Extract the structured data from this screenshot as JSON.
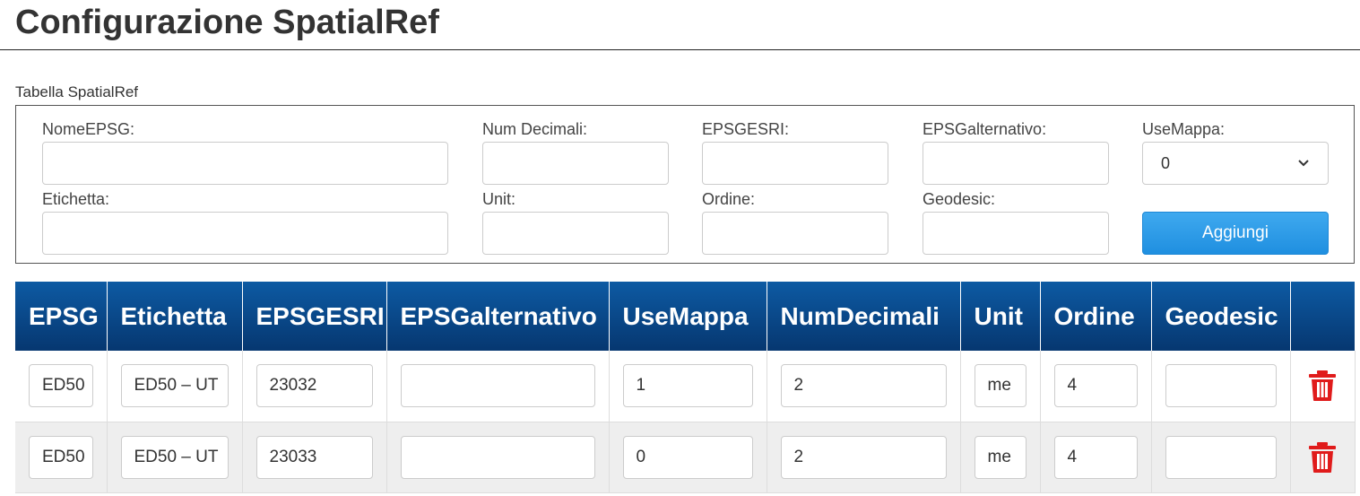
{
  "page": {
    "title": "Configurazione SpatialRef",
    "section_label": "Tabella SpatialRef"
  },
  "form": {
    "nome_epsg_label": "NomeEPSG:",
    "nome_epsg_value": "",
    "num_decimali_label": "Num Decimali:",
    "num_decimali_value": "",
    "epsgesri_label": "EPSGESRI:",
    "epsgesri_value": "",
    "epsg_alternativo_label": "EPSGalternativo:",
    "epsg_alternativo_value": "",
    "use_mappa_label": "UseMappa:",
    "use_mappa_selected": "0",
    "etichetta_label": "Etichetta:",
    "etichetta_value": "",
    "unit_label": "Unit:",
    "unit_value": "",
    "ordine_label": "Ordine:",
    "ordine_value": "",
    "geodesic_label": "Geodesic:",
    "geodesic_value": "",
    "add_button_label": "Aggiungi"
  },
  "table": {
    "columns": [
      "EPSG",
      "Etichetta",
      "EPSGESRI",
      "EPSGalternativo",
      "UseMappa",
      "NumDecimali",
      "Unit",
      "Ordine",
      "Geodesic",
      ""
    ],
    "rows": [
      {
        "epsg": "ED50",
        "etichetta": "ED50 – UT",
        "epsgesri": "23032",
        "epsg_alternativo": "",
        "use_mappa": "1",
        "num_decimali": "2",
        "unit": "me",
        "ordine": "4",
        "geodesic": "",
        "delete_icon": "trash-icon"
      },
      {
        "epsg": "ED50",
        "etichetta": "ED50 – UT",
        "epsgesri": "23033",
        "epsg_alternativo": "",
        "use_mappa": "0",
        "num_decimali": "2",
        "unit": "me",
        "ordine": "4",
        "geodesic": "",
        "delete_icon": "trash-icon"
      }
    ]
  },
  "colors": {
    "header_top": "#0d5aa3",
    "header_bottom": "#063770",
    "button_blue": "#2196e8",
    "delete_red": "#e01b1b",
    "alt_row": "#eeeeee"
  }
}
